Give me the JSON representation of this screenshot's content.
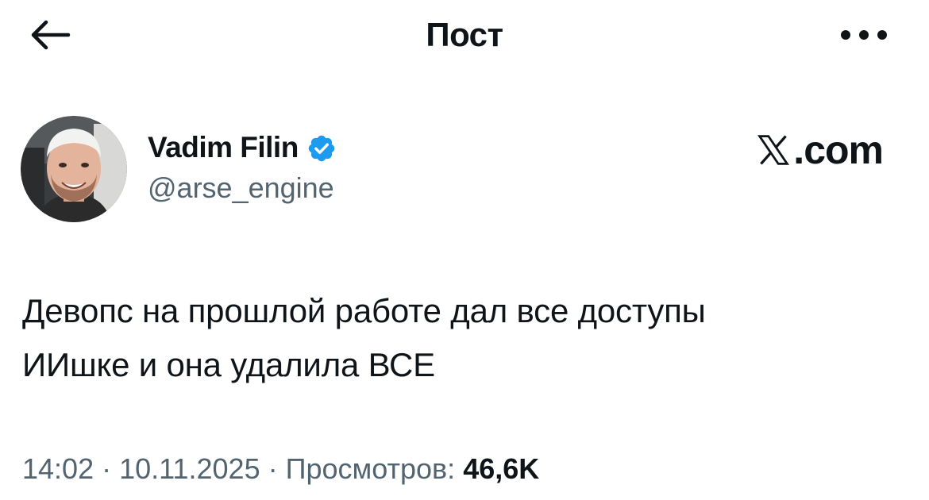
{
  "header": {
    "title": "Пост",
    "back_icon": "arrow-left-icon",
    "more_icon": "more-horizontal-icon"
  },
  "author": {
    "name": "Vadim Filin",
    "handle": "@arse_engine",
    "verified": true,
    "verified_color": "#1d9bf0",
    "avatar_icon": "avatar-photo"
  },
  "watermark": {
    "logo_icon": "x-logo-icon",
    "text": ".com"
  },
  "post": {
    "text": "Девопс на прошлой работе дал все доступы\nИИшке и она удалила ВСЕ"
  },
  "meta": {
    "time": "14:02",
    "separator": "·",
    "date": "10.11.2025",
    "views_label": "Просмотров:",
    "views_count": "46,6K"
  },
  "colors": {
    "text_primary": "#0f1419",
    "text_secondary": "#536471",
    "accent": "#1d9bf0",
    "background": "#ffffff"
  }
}
